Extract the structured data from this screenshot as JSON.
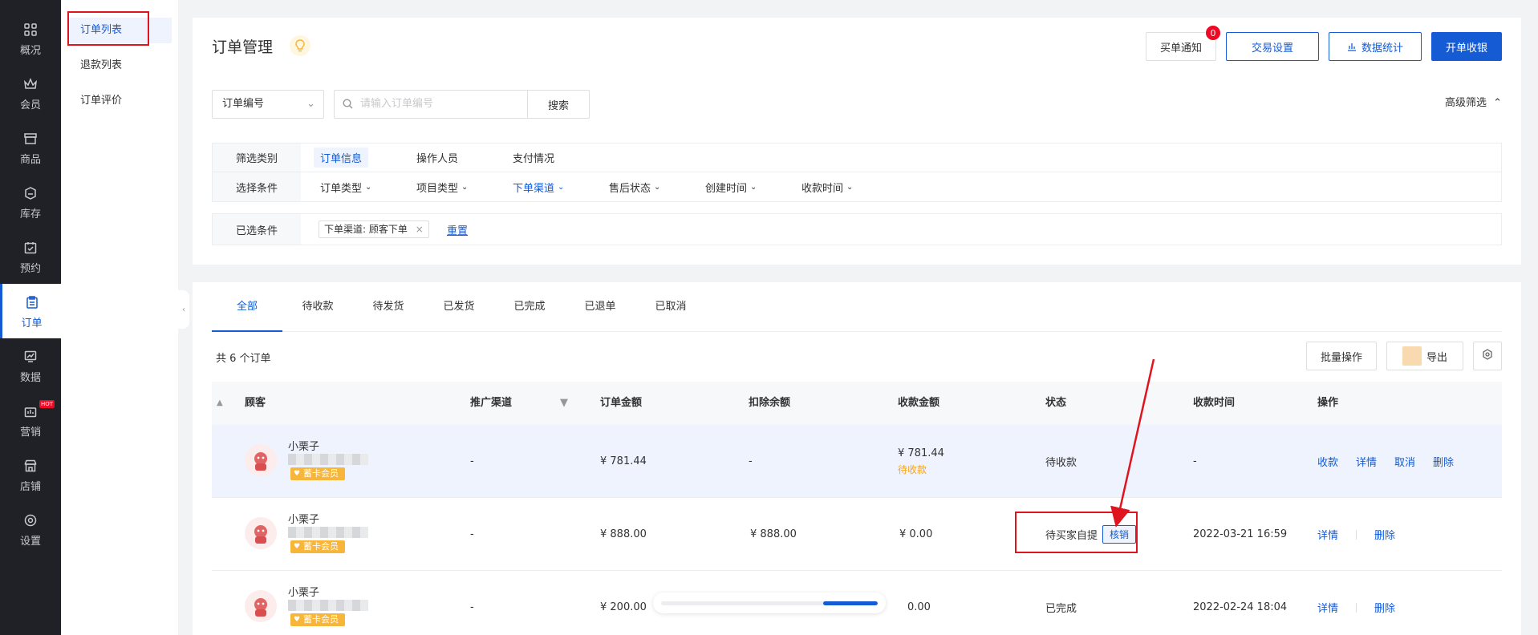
{
  "rail": [
    {
      "label": "概况",
      "icon": "grid-icon"
    },
    {
      "label": "会员",
      "icon": "crown-icon"
    },
    {
      "label": "商品",
      "icon": "store-icon"
    },
    {
      "label": "库存",
      "icon": "box-icon"
    },
    {
      "label": "预约",
      "icon": "calendar-check-icon"
    },
    {
      "label": "订单",
      "icon": "clipboard-icon",
      "active": true
    },
    {
      "label": "数据",
      "icon": "chart-icon"
    },
    {
      "label": "营销",
      "icon": "marketing-icon",
      "badge": "HOT"
    },
    {
      "label": "店铺",
      "icon": "shop-icon"
    },
    {
      "label": "设置",
      "icon": "settings-icon"
    }
  ],
  "subnav": [
    {
      "label": "订单列表",
      "active": true
    },
    {
      "label": "退款列表"
    },
    {
      "label": "订单评价"
    }
  ],
  "header": {
    "title": "订单管理",
    "notify_label": "买单通知",
    "notify_count": "0",
    "trade_settings_label": "交易设置",
    "stats_label": "数据统计",
    "checkout_label": "开单收银"
  },
  "search": {
    "field_select": "订单编号",
    "placeholder": "请输入订单编号",
    "button_label": "搜索",
    "advanced_label": "高级筛选"
  },
  "filters": {
    "category_label": "筛选类别",
    "categories": [
      "订单信息",
      "操作人员",
      "支付情况"
    ],
    "condition_label": "选择条件",
    "conditions": [
      "订单类型",
      "项目类型",
      "下单渠道",
      "售后状态",
      "创建时间",
      "收款时间"
    ],
    "selected_label": "已选条件",
    "selected_tag": "下单渠道: 顾客下单",
    "reset_label": "重置"
  },
  "tabs": [
    "全部",
    "待收款",
    "待发货",
    "已发货",
    "已完成",
    "已退单",
    "已取消"
  ],
  "list": {
    "count_text": "共 6 个订单",
    "batch_label": "批量操作",
    "export_label": "导出"
  },
  "table": {
    "headers": [
      "顾客",
      "推广渠道",
      "订单金额",
      "扣除余额",
      "收款金额",
      "状态",
      "收款时间",
      "操作"
    ],
    "rows": [
      {
        "name": "小栗子",
        "badge": "蓄卡会员",
        "channel": "-",
        "amount": "¥ 781.44",
        "deduct": "-",
        "received": "¥ 781.44",
        "received_sub": "待收款",
        "status": "待收款",
        "time": "-",
        "actions": [
          "收款",
          "详情",
          "取消",
          "删除"
        ]
      },
      {
        "name": "小栗子",
        "badge": "蓄卡会员",
        "channel": "-",
        "amount": "¥ 888.00",
        "deduct": "¥ 888.00",
        "received": "¥ 0.00",
        "received_sub": "",
        "status": "待买家自提",
        "status_action": "核销",
        "time": "2022-03-21 16:59",
        "actions": [
          "详情",
          "删除"
        ]
      },
      {
        "name": "小栗子",
        "badge": "蓄卡会员",
        "channel": "-",
        "amount": "¥ 200.00",
        "deduct": "",
        "received": "0.00",
        "received_sub": "",
        "status": "已完成",
        "time": "2022-02-24 18:04",
        "actions": [
          "详情",
          "删除"
        ]
      }
    ]
  },
  "scroll_progress": 0.25,
  "colors": {
    "primary": "#155bd4",
    "annotation": "#e0141e",
    "rail_bg": "#1f2127"
  }
}
